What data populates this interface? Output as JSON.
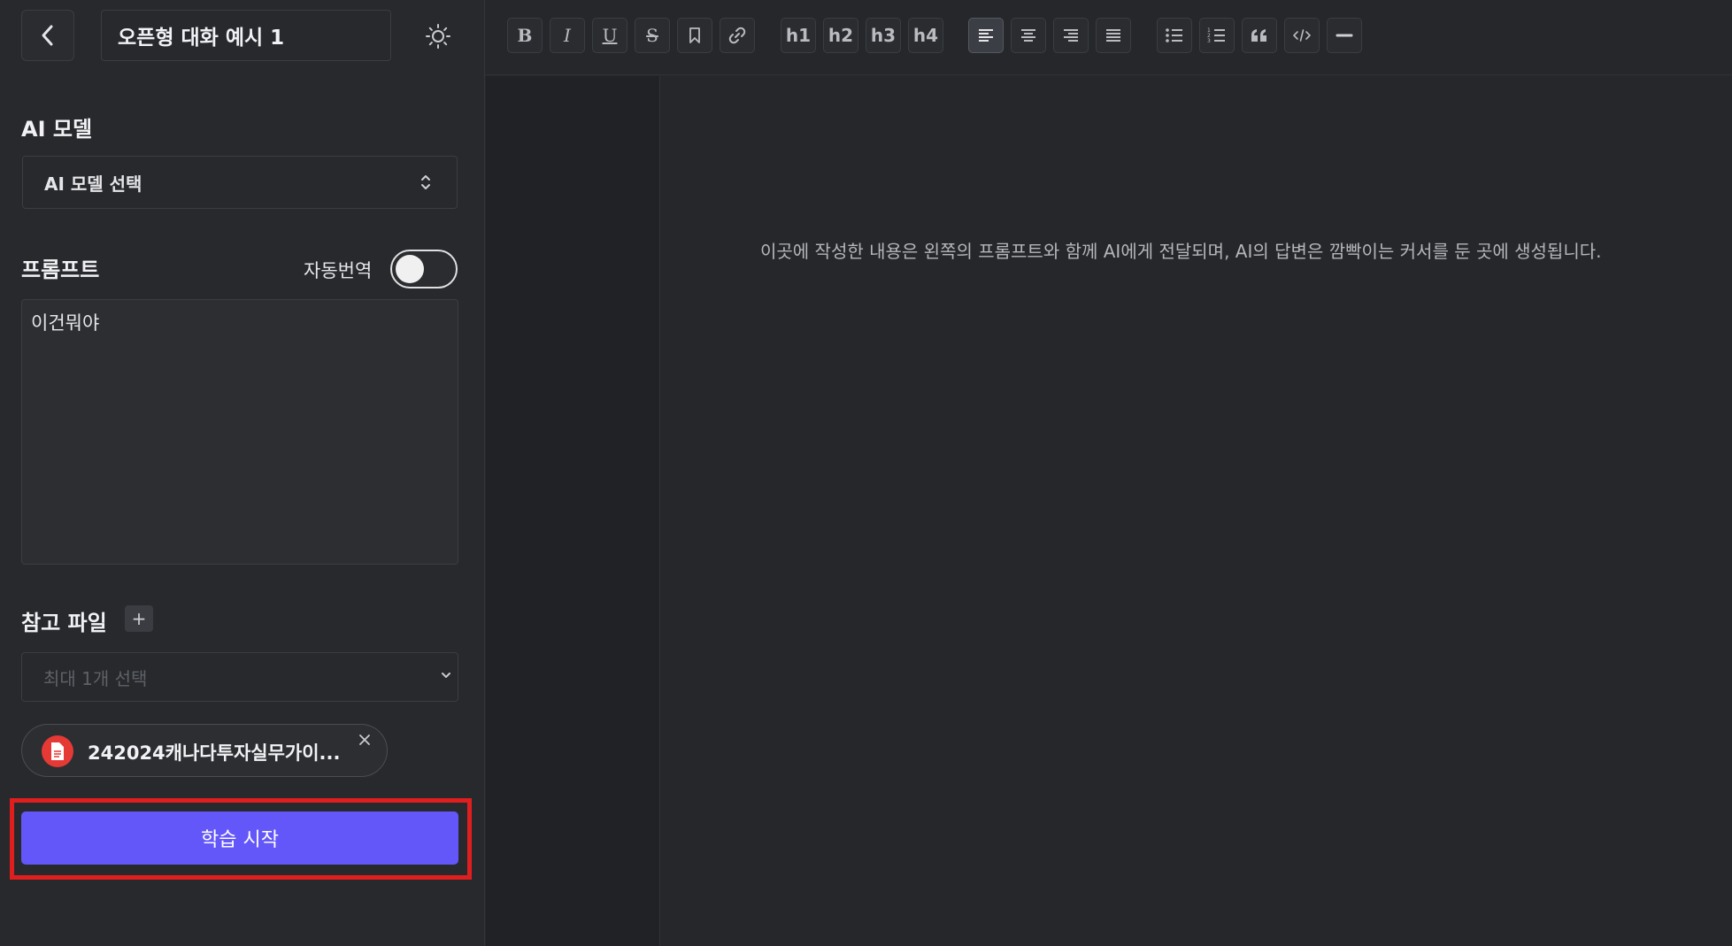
{
  "header": {
    "title": "오픈형 대화 예시 1"
  },
  "model": {
    "label": "AI 모델",
    "select_value": "AI 모델 선택"
  },
  "prompt": {
    "label": "프롬프트",
    "auto_translate_label": "자동번역",
    "auto_translate_on": false,
    "value": "이건뭐야"
  },
  "reference": {
    "label": "참고 파일",
    "add_symbol": "+",
    "select_placeholder": "최대 1개 선택",
    "chip_name": "242024캐나다투자실무가이..."
  },
  "actions": {
    "start_label": "학습 시작"
  },
  "toolbar": {
    "bold": "B",
    "italic": "I",
    "underline": "U",
    "strike": "S",
    "h1": "h1",
    "h2": "h2",
    "h3": "h3",
    "h4": "h4"
  },
  "editor": {
    "placeholder": "이곳에 작성한 내용은 왼쪽의 프롬프트와 함께 AI에게 전달되며, AI의 답변은 깜빡이는 커서를 둔 곳에 생성됩니다."
  },
  "colors": {
    "accent": "#6457f9",
    "highlight": "#e01e1e",
    "pdf": "#e53935"
  }
}
